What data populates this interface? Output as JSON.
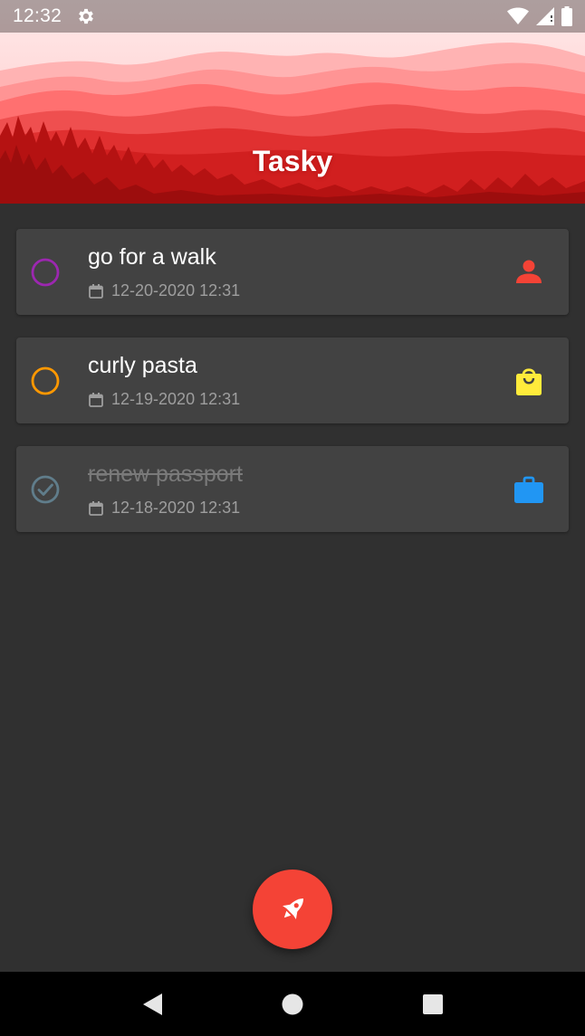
{
  "status_bar": {
    "time": "12:32",
    "icons": [
      "gear-icon",
      "wifi-icon",
      "signal-icon",
      "battery-icon"
    ]
  },
  "header": {
    "title": "Tasky"
  },
  "tasks": [
    {
      "title": "go for a walk",
      "date": "12-20-2020 12:31",
      "completed": false,
      "check_color": "#9c27b0",
      "category_icon": "person-icon",
      "category_color": "#f44336"
    },
    {
      "title": "curly pasta",
      "date": "12-19-2020 12:31",
      "completed": false,
      "check_color": "#ff9800",
      "category_icon": "shopping-bag-icon",
      "category_color": "#ffeb3b"
    },
    {
      "title": "renew passport",
      "date": "12-18-2020 12:31",
      "completed": true,
      "check_color": "#607d8b",
      "category_icon": "briefcase-icon",
      "category_color": "#2196f3"
    }
  ],
  "fab": {
    "icon": "rocket-icon",
    "color": "#f44336"
  },
  "nav_bar": {
    "icons": [
      "back-icon",
      "home-icon",
      "recents-icon"
    ]
  },
  "colors": {
    "background": "#303030",
    "card": "#424242",
    "accent": "#f44336"
  }
}
